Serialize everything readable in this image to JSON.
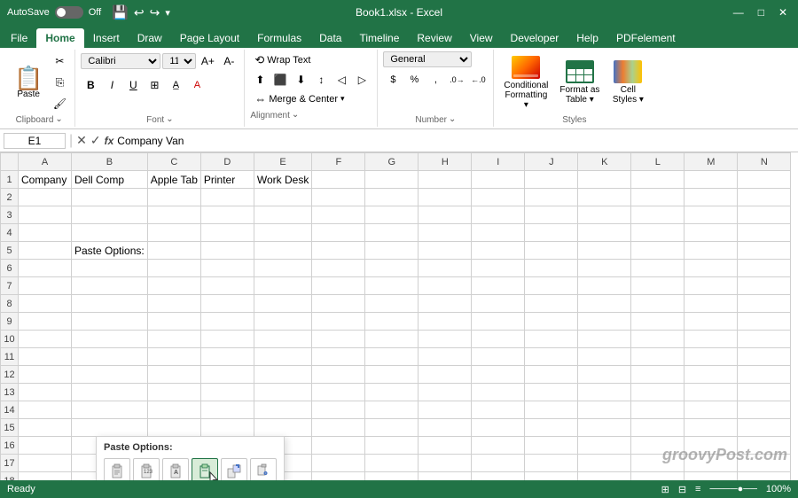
{
  "titleBar": {
    "autosave": "AutoSave",
    "toggleState": "Off",
    "filename": "Book1.xlsx - Excel",
    "windowControls": [
      "—",
      "□",
      "✕"
    ]
  },
  "ribbonTabs": {
    "tabs": [
      "File",
      "Home",
      "Insert",
      "Draw",
      "Page Layout",
      "Formulas",
      "Data",
      "Timeline",
      "Review",
      "View",
      "Developer",
      "Help",
      "PDFelement"
    ],
    "activeTab": "Home"
  },
  "clipboard": {
    "groupLabel": "Clipboard",
    "pasteLabel": "Paste",
    "expandIcon": "⌄"
  },
  "font": {
    "groupLabel": "Font",
    "fontName": "Calibri",
    "fontSize": "11",
    "boldLabel": "B",
    "italicLabel": "I",
    "underlineLabel": "U",
    "expandIcon": "⌄"
  },
  "alignment": {
    "groupLabel": "Alignment",
    "wrapText": "Wrap Text",
    "mergeCenter": "Merge & Center",
    "expandIcon": "⌄"
  },
  "number": {
    "groupLabel": "Number",
    "format": "General",
    "expandIcon": "⌄"
  },
  "styles": {
    "groupLabel": "Styles",
    "conditionalFormatting": "Conditional Formatting",
    "formatAsTable": "Format as Table",
    "cellStyles": "Cell Styles"
  },
  "formulaBar": {
    "nameBox": "E1",
    "formula": "Company Van"
  },
  "columns": [
    "A",
    "B",
    "C",
    "D",
    "E",
    "F",
    "G",
    "H",
    "I",
    "J",
    "K",
    "L",
    "M",
    "N"
  ],
  "rows": [
    {
      "num": 1,
      "cells": [
        "Company",
        "Dell Comp",
        "Apple Tab",
        "Printer",
        "Work Desk",
        "",
        "",
        "",
        "",
        "",
        "",
        "",
        "",
        ""
      ]
    },
    {
      "num": 2,
      "cells": [
        "",
        "",
        "",
        "",
        "",
        "",
        "",
        "",
        "",
        "",
        "",
        "",
        "",
        ""
      ]
    },
    {
      "num": 3,
      "cells": [
        "",
        "",
        "",
        "",
        "",
        "",
        "",
        "",
        "",
        "",
        "",
        "",
        "",
        ""
      ]
    },
    {
      "num": 4,
      "cells": [
        "",
        "",
        "",
        "",
        "",
        "",
        "",
        "",
        "",
        "",
        "",
        "",
        "",
        ""
      ]
    },
    {
      "num": 5,
      "cells": [
        "",
        "Paste Options:",
        "",
        "",
        "",
        "",
        "",
        "",
        "",
        "",
        "",
        "",
        "",
        ""
      ]
    },
    {
      "num": 6,
      "cells": [
        "",
        "",
        "",
        "",
        "",
        "",
        "",
        "",
        "",
        "",
        "",
        "",
        "",
        ""
      ]
    },
    {
      "num": 7,
      "cells": [
        "",
        "",
        "",
        "",
        "",
        "",
        "",
        "",
        "",
        "",
        "",
        "",
        "",
        ""
      ]
    },
    {
      "num": 8,
      "cells": [
        "",
        "",
        "",
        "",
        "",
        "",
        "",
        "",
        "",
        "",
        "",
        "",
        "",
        ""
      ]
    },
    {
      "num": 9,
      "cells": [
        "",
        "",
        "",
        "",
        "",
        "",
        "",
        "",
        "",
        "",
        "",
        "",
        "",
        ""
      ]
    },
    {
      "num": 10,
      "cells": [
        "",
        "",
        "",
        "",
        "",
        "",
        "",
        "",
        "",
        "",
        "",
        "",
        "",
        ""
      ]
    },
    {
      "num": 11,
      "cells": [
        "",
        "",
        "",
        "",
        "",
        "",
        "",
        "",
        "",
        "",
        "",
        "",
        "",
        ""
      ]
    },
    {
      "num": 12,
      "cells": [
        "",
        "",
        "",
        "",
        "",
        "",
        "",
        "",
        "",
        "",
        "",
        "",
        "",
        ""
      ]
    },
    {
      "num": 13,
      "cells": [
        "",
        "",
        "",
        "",
        "",
        "",
        "",
        "",
        "",
        "",
        "",
        "",
        "",
        ""
      ]
    },
    {
      "num": 14,
      "cells": [
        "",
        "",
        "",
        "",
        "",
        "",
        "",
        "",
        "",
        "",
        "",
        "",
        "",
        ""
      ]
    },
    {
      "num": 15,
      "cells": [
        "",
        "",
        "",
        "",
        "",
        "",
        "",
        "",
        "",
        "",
        "",
        "",
        "",
        ""
      ]
    },
    {
      "num": 16,
      "cells": [
        "",
        "",
        "",
        "",
        "",
        "",
        "",
        "",
        "",
        "",
        "",
        "",
        "",
        ""
      ]
    },
    {
      "num": 17,
      "cells": [
        "",
        "",
        "",
        "",
        "",
        "",
        "",
        "",
        "",
        "",
        "",
        "",
        "",
        ""
      ]
    },
    {
      "num": 18,
      "cells": [
        "",
        "",
        "",
        "",
        "",
        "",
        "",
        "",
        "",
        "",
        "",
        "",
        "",
        ""
      ]
    }
  ],
  "pasteOptions": {
    "title": "Paste Options:",
    "buttons": [
      "📋",
      "🔢",
      "A",
      "📄",
      "✏️",
      "🔗"
    ]
  },
  "watermark": "groovyPost.com",
  "statusBar": {
    "mode": "Ready",
    "rightItems": [
      "Normal",
      "Page Layout",
      "Page Break Preview"
    ]
  }
}
